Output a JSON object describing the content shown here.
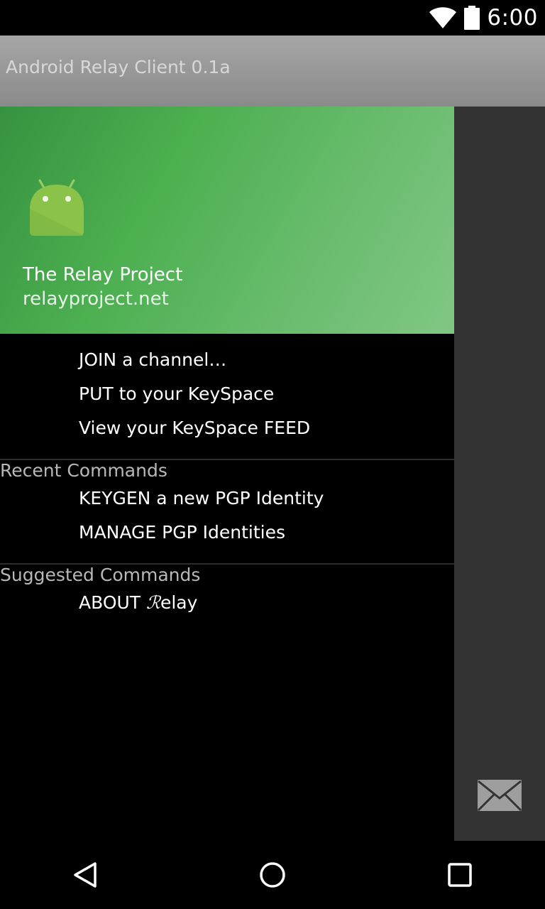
{
  "status_bar": {
    "time": "6:00",
    "wifi_icon": "wifi-icon",
    "battery_icon": "battery-icon"
  },
  "app_bar": {
    "title": "Android Relay Client 0.1a"
  },
  "drawer": {
    "header": {
      "logo_icon": "android-icon",
      "title": "The Relay Project",
      "subtitle": "relayproject.net",
      "colors": [
        "#36923f",
        "#4caf50",
        "#81c784"
      ]
    },
    "primary_items": [
      {
        "label": "JOIN a channel…"
      },
      {
        "label": "PUT to your KeySpace"
      },
      {
        "label": "View your KeySpace FEED"
      }
    ],
    "recent": {
      "label": "Recent Commands",
      "items": [
        {
          "label": "KEYGEN a new PGP Identity"
        },
        {
          "label": "MANAGE PGP Identities"
        }
      ]
    },
    "suggested": {
      "label": "Suggested Commands",
      "items": [
        {
          "label_prefix": "ABOUT ",
          "label_script": "ℛ",
          "label_suffix": "elay"
        }
      ]
    }
  },
  "fab": {
    "icon": "mail-icon"
  },
  "nav_bar": {
    "back_icon": "back-icon",
    "home_icon": "home-icon",
    "recents_icon": "recents-icon"
  }
}
